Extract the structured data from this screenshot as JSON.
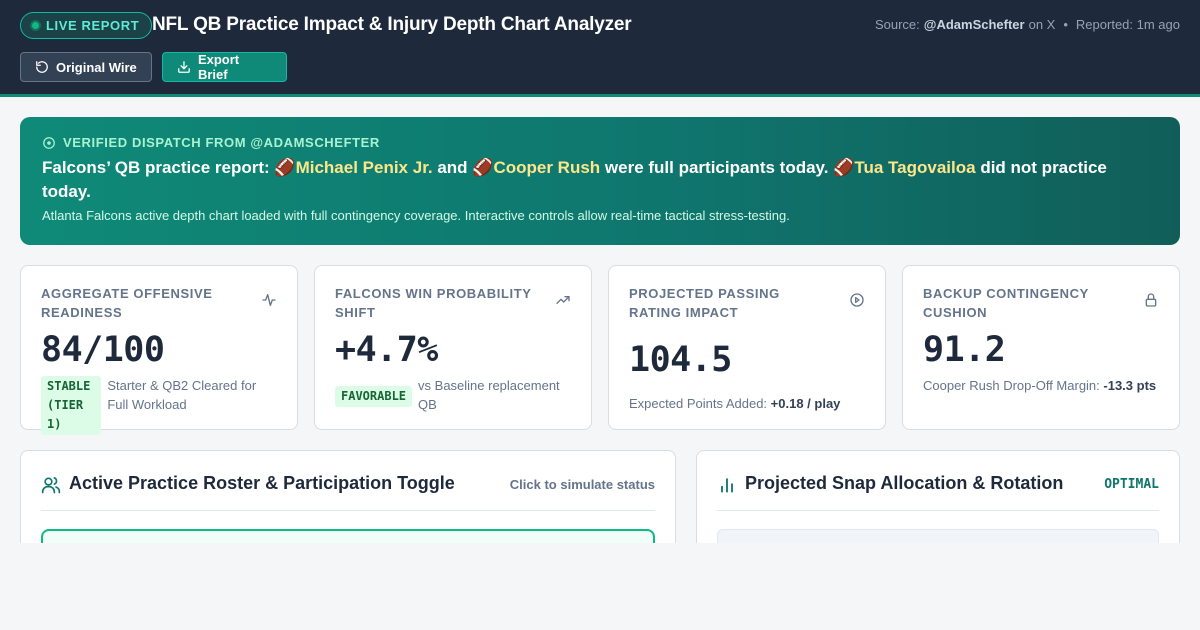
{
  "header": {
    "live_label": "LIVE REPORT",
    "title": "NFL QB Practice Impact & Injury Depth Chart Analyzer",
    "source_prefix": "Source:",
    "source_handle": "@AdamSchefter",
    "source_suffix": "on X",
    "separator": "•",
    "reported": "Reported: 1m ago",
    "buttons": {
      "original_wire": "Original Wire",
      "export_brief": "Export Brief"
    }
  },
  "banner": {
    "tag": "VERIFIED DISPATCH FROM @ADAMSCHEFTER",
    "headline_parts": {
      "intro": "Falcons’ QB practice report: ",
      "emoji": "🏈",
      "player1": "Michael Penix Jr.",
      "and": " and ",
      "player2": "Cooper Rush",
      "mid": " were full participants today. ",
      "player3": "Tua Tagovailoa",
      "end": " did not practice today."
    },
    "sub": "Atlanta Falcons active depth chart loaded with full contingency coverage. Interactive controls allow real-time tactical stress-testing."
  },
  "stats": [
    {
      "label": "AGGREGATE OFFENSIVE READINESS",
      "icon": "activity-icon",
      "value": "84/100",
      "badge": "STABLE (TIER 1)",
      "note": "Starter & QB2 Cleared for Full Workload"
    },
    {
      "label": "FALCONS WIN PROBABILITY SHIFT",
      "icon": "trending-up-icon",
      "value": "+4.7%",
      "badge": "FAVORABLE",
      "note": "vs Baseline replacement QB"
    },
    {
      "label": "PROJECTED PASSING RATING IMPACT",
      "icon": "play-circle-icon",
      "value": "104.5",
      "note_prefix": "Expected Points Added: ",
      "note_strong": "+0.18 / play"
    },
    {
      "label": "BACKUP CONTINGENCY CUSHION",
      "icon": "lock-icon",
      "value": "91.2",
      "note_prefix": "Cooper Rush Drop-Off Margin: ",
      "note_strong": "-13.3 pts"
    }
  ],
  "panels": {
    "roster": {
      "title": "Active Practice Roster & Participation Toggle",
      "hint": "Click to simulate status"
    },
    "snaps": {
      "title": "Projected Snap Allocation & Rotation",
      "status": "OPTIMAL"
    }
  },
  "colors": {
    "header_bg": "#1e293b",
    "accent": "#0f8a78",
    "highlight": "#fde68a",
    "badge_bg": "#dcfce7"
  }
}
